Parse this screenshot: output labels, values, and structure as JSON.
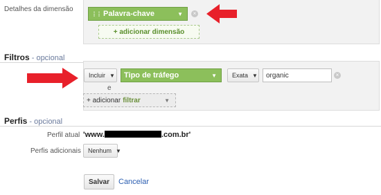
{
  "dimension": {
    "label": "Detalhes da dimensão",
    "pill": "Palavra-chave",
    "add": "+ adicionar dimensão"
  },
  "filters": {
    "title": "Filtros",
    "optional": " - opcional",
    "include": "Incluir",
    "field": "Tipo de tráfego",
    "match": "Exata",
    "value": "organic",
    "conj": "e",
    "add_prefix": "+ adicionar",
    "add_kw": "filtrar"
  },
  "profiles": {
    "title": "Perfis",
    "optional": " - opcional",
    "current_label": "Perfil atual",
    "current_prefix": "'www.",
    "current_suffix": ".com.br'",
    "additional_label": "Perfis adicionais",
    "additional_value": "Nenhum"
  },
  "actions": {
    "save": "Salvar",
    "cancel": "Cancelar"
  },
  "colors": {
    "accent_green": "#8cbf5b",
    "arrow_red": "#e8202a",
    "link": "#2a5db0"
  }
}
